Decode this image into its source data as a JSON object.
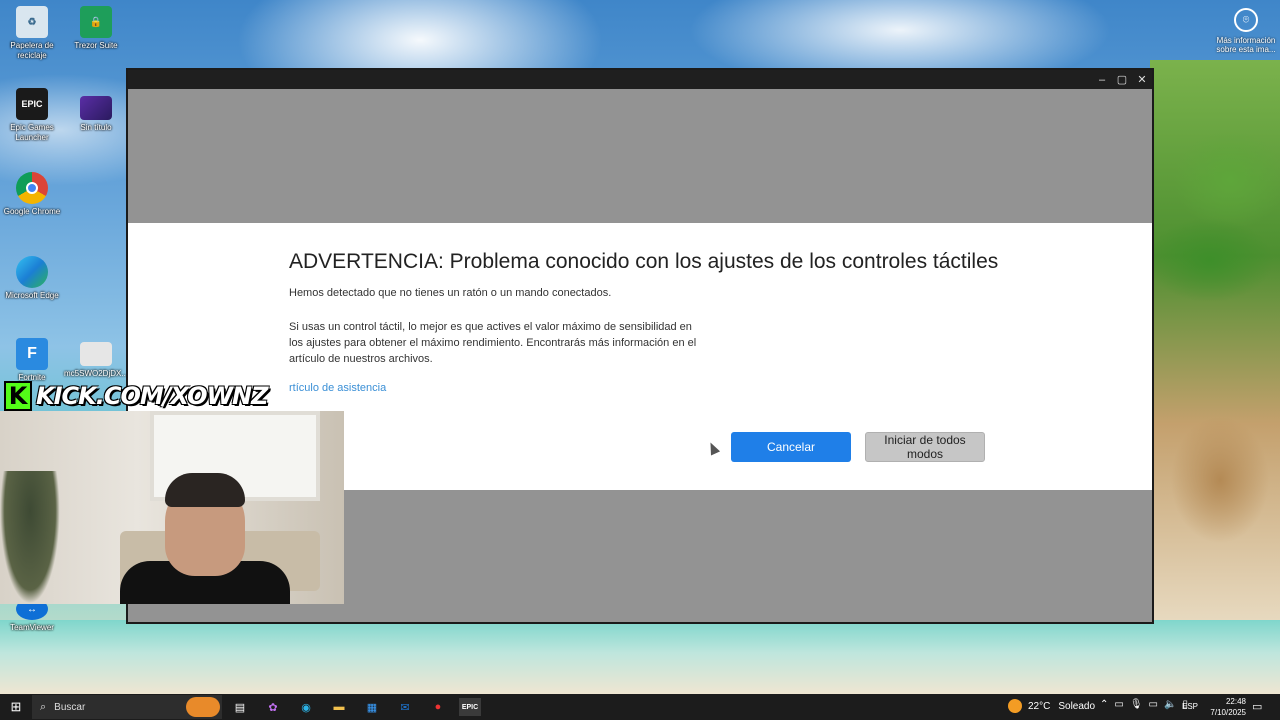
{
  "desktop": {
    "icons": [
      {
        "label": "Papelera de reciclaje",
        "icon": "recycle-bin-icon"
      },
      {
        "label": "Trezor Suite",
        "icon": "trezor-icon"
      },
      {
        "label": "Epic Games Launcher",
        "icon": "epic-games-icon",
        "glyph": "EPIC"
      },
      {
        "label": "Sin título",
        "icon": "image-file-icon"
      },
      {
        "label": "Google Chrome",
        "icon": "chrome-icon"
      },
      {
        "label": "Microsoft Edge",
        "icon": "edge-icon"
      },
      {
        "label": "Fortnite",
        "icon": "fortnite-icon",
        "glyph": "F"
      },
      {
        "label": "mc5SWO2DjDX...",
        "icon": "file-icon"
      },
      {
        "label": "TeamViewer",
        "icon": "teamviewer-icon"
      }
    ],
    "info_label": "Más información sobre esta ima..."
  },
  "window": {
    "controls": {
      "minimize": "–",
      "maximize": "▢",
      "close": "✕"
    }
  },
  "dialog": {
    "title": "ADVERTENCIA: Problema conocido con los ajustes de los controles táctiles",
    "line1": "Hemos detectado que no tienes un ratón o un mando conectados.",
    "paragraph": "Si usas un control táctil, lo mejor es que actives el valor máximo de sensibilidad en los ajustes para obtener el máximo rendimiento. Encontrarás más información en el artículo de nuestros archivos.",
    "link": "rtículo de asistencia",
    "cancel_label": "Cancelar",
    "start_label": "Iniciar de todos modos"
  },
  "overlay": {
    "kick_letter": "K",
    "kick_text": "KICK.COM/XOWNZ"
  },
  "taskbar": {
    "search_placeholder": "Buscar",
    "temperature": "22°C",
    "weather": "Soleado",
    "language": "ESP",
    "time": "22:48",
    "date": "7/10/2025"
  },
  "colors": {
    "accent_blue": "#1f7fe8",
    "link_blue": "#3a8fd6",
    "kick_green": "#53fc18"
  }
}
